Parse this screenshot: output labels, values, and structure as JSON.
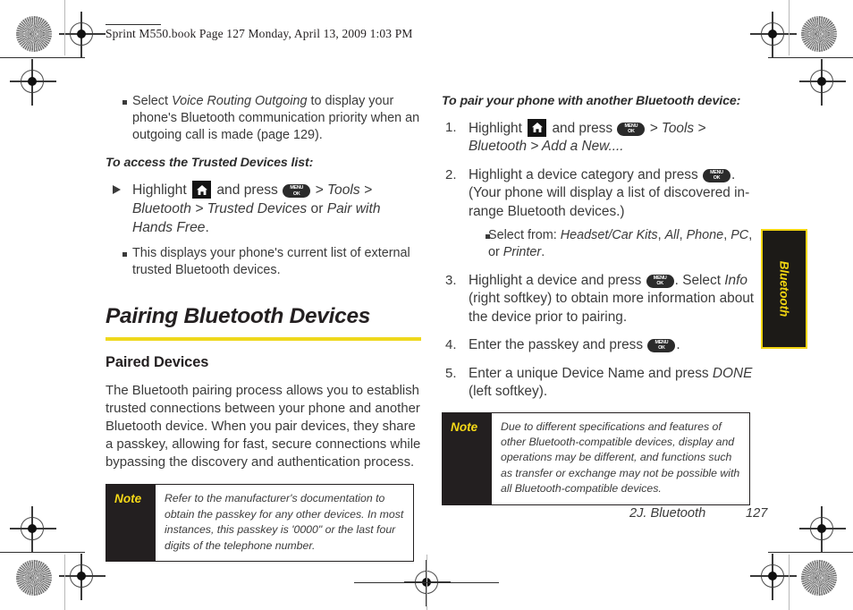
{
  "header": {
    "running_head": "Sprint M550.book  Page 127  Monday, April 13, 2009  1:03 PM"
  },
  "left_column": {
    "bullet_top": {
      "pre": "Select ",
      "emphasis": "Voice Routing Outgoing",
      "post": " to display your phone's Bluetooth communication priority when an outgoing call is made (page 129)."
    },
    "lead_in": "To access the Trusted Devices list:",
    "arrow_step": {
      "part1": "Highlight ",
      "part2": " and press ",
      "menu_path": " > Tools > Bluetooth > ",
      "option_a": "Trusted Devices",
      "conjunction": " or ",
      "option_b": "Pair with Hands Free",
      "end": "."
    },
    "sub_bullet": "This displays your phone's current list of external trusted Bluetooth devices.",
    "section_heading": "Pairing Bluetooth Devices",
    "sub_heading": "Paired Devices",
    "paragraph": "The Bluetooth pairing process allows you to establish trusted connections between your phone and another Bluetooth device. When you pair devices, they share a passkey, allowing for fast, secure connections while bypassing the discovery and authentication process.",
    "note": {
      "tag": "Note",
      "text": "Refer to the manufacturer's documentation to obtain the passkey for any other devices. In most instances, this passkey is '0000\" or the last four digits of the telephone number."
    }
  },
  "right_column": {
    "lead_in": "To pair your phone with another Bluetooth device:",
    "step1": {
      "number": "1.",
      "part1": "Highlight ",
      "part2": " and press ",
      "menu_path": " > Tools > Bluetooth > ",
      "target": "Add a New...."
    },
    "step2": {
      "number": "2.",
      "part1": "Highlight a device category and press ",
      "part2": ". (Your phone will display a list of discovered in-range Bluetooth devices.)",
      "sub_bullet": {
        "pre": "Select from: ",
        "options": [
          "Headset/Car Kits",
          "All",
          "Phone",
          "PC"
        ],
        "conjunction": ", or ",
        "last_option": "Printer",
        "end": "."
      }
    },
    "step3": {
      "number": "3.",
      "part1": "Highlight a device and press ",
      "part2": ". Select ",
      "emphasis": "Info",
      "part3": " (right softkey) to obtain more information about the device prior to pairing."
    },
    "step4": {
      "number": "4.",
      "part1": "Enter the passkey and press ",
      "part2": "."
    },
    "step5": {
      "number": "5.",
      "part1": "Enter a unique Device Name and press ",
      "emphasis": "DONE",
      "part2": " (left softkey)."
    },
    "note": {
      "tag": "Note",
      "text": "Due to different specifications and features of other Bluetooth-compatible devices, display and operations may be different, and functions such as transfer or exchange may not be possible with all Bluetooth-compatible devices."
    }
  },
  "side_tab": {
    "label": "Bluetooth"
  },
  "footer": {
    "section": "2J. Bluetooth",
    "page_number": "127"
  },
  "keys": {
    "menu_key_line1": "MENU",
    "menu_key_line2": "OK",
    "home_key_name": "home-key-icon"
  },
  "colors": {
    "accent_yellow": "#efd81c",
    "tab_yellow": "#f2d511",
    "ink": "#231f20",
    "body_text": "#3b3b3b"
  }
}
